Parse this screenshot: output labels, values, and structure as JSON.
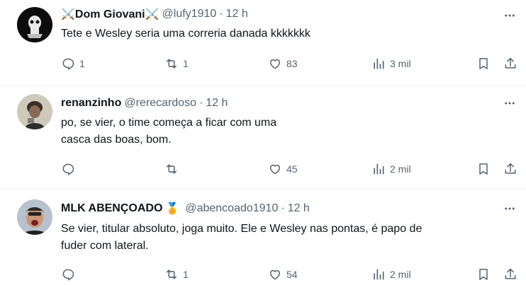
{
  "tweets": [
    {
      "name": "⚔️Dom Giovani⚔️",
      "handle": "@lufy1910",
      "time": "12 h",
      "text_lines": [
        "Tete e Wesley seria uma correria danada kkkkkkk"
      ],
      "replies": "1",
      "retweets": "1",
      "likes": "83",
      "views": "3 mil"
    },
    {
      "name": "renanzinho",
      "handle": "@rerecardoso",
      "time": "12 h",
      "text_lines": [
        "po, se vier, o time começa a ficar com uma",
        "casca das boas, bom."
      ],
      "replies": "",
      "retweets": "",
      "likes": "45",
      "views": "2 mil"
    },
    {
      "name": "MLK ABENÇOADO",
      "badge": "🏅",
      "handle": "@abencoado1910",
      "time": "12 h",
      "text_lines": [
        "Se vier, titular absoluto, joga muito. Ele e Wesley nas pontas, é papo de",
        "fuder com lateral."
      ],
      "replies": "",
      "retweets": "1",
      "likes": "54",
      "views": "2 mil"
    }
  ],
  "separator": "·",
  "colors": {
    "text": "#0f1419",
    "secondary": "#536471",
    "border": "#eff3f4"
  }
}
